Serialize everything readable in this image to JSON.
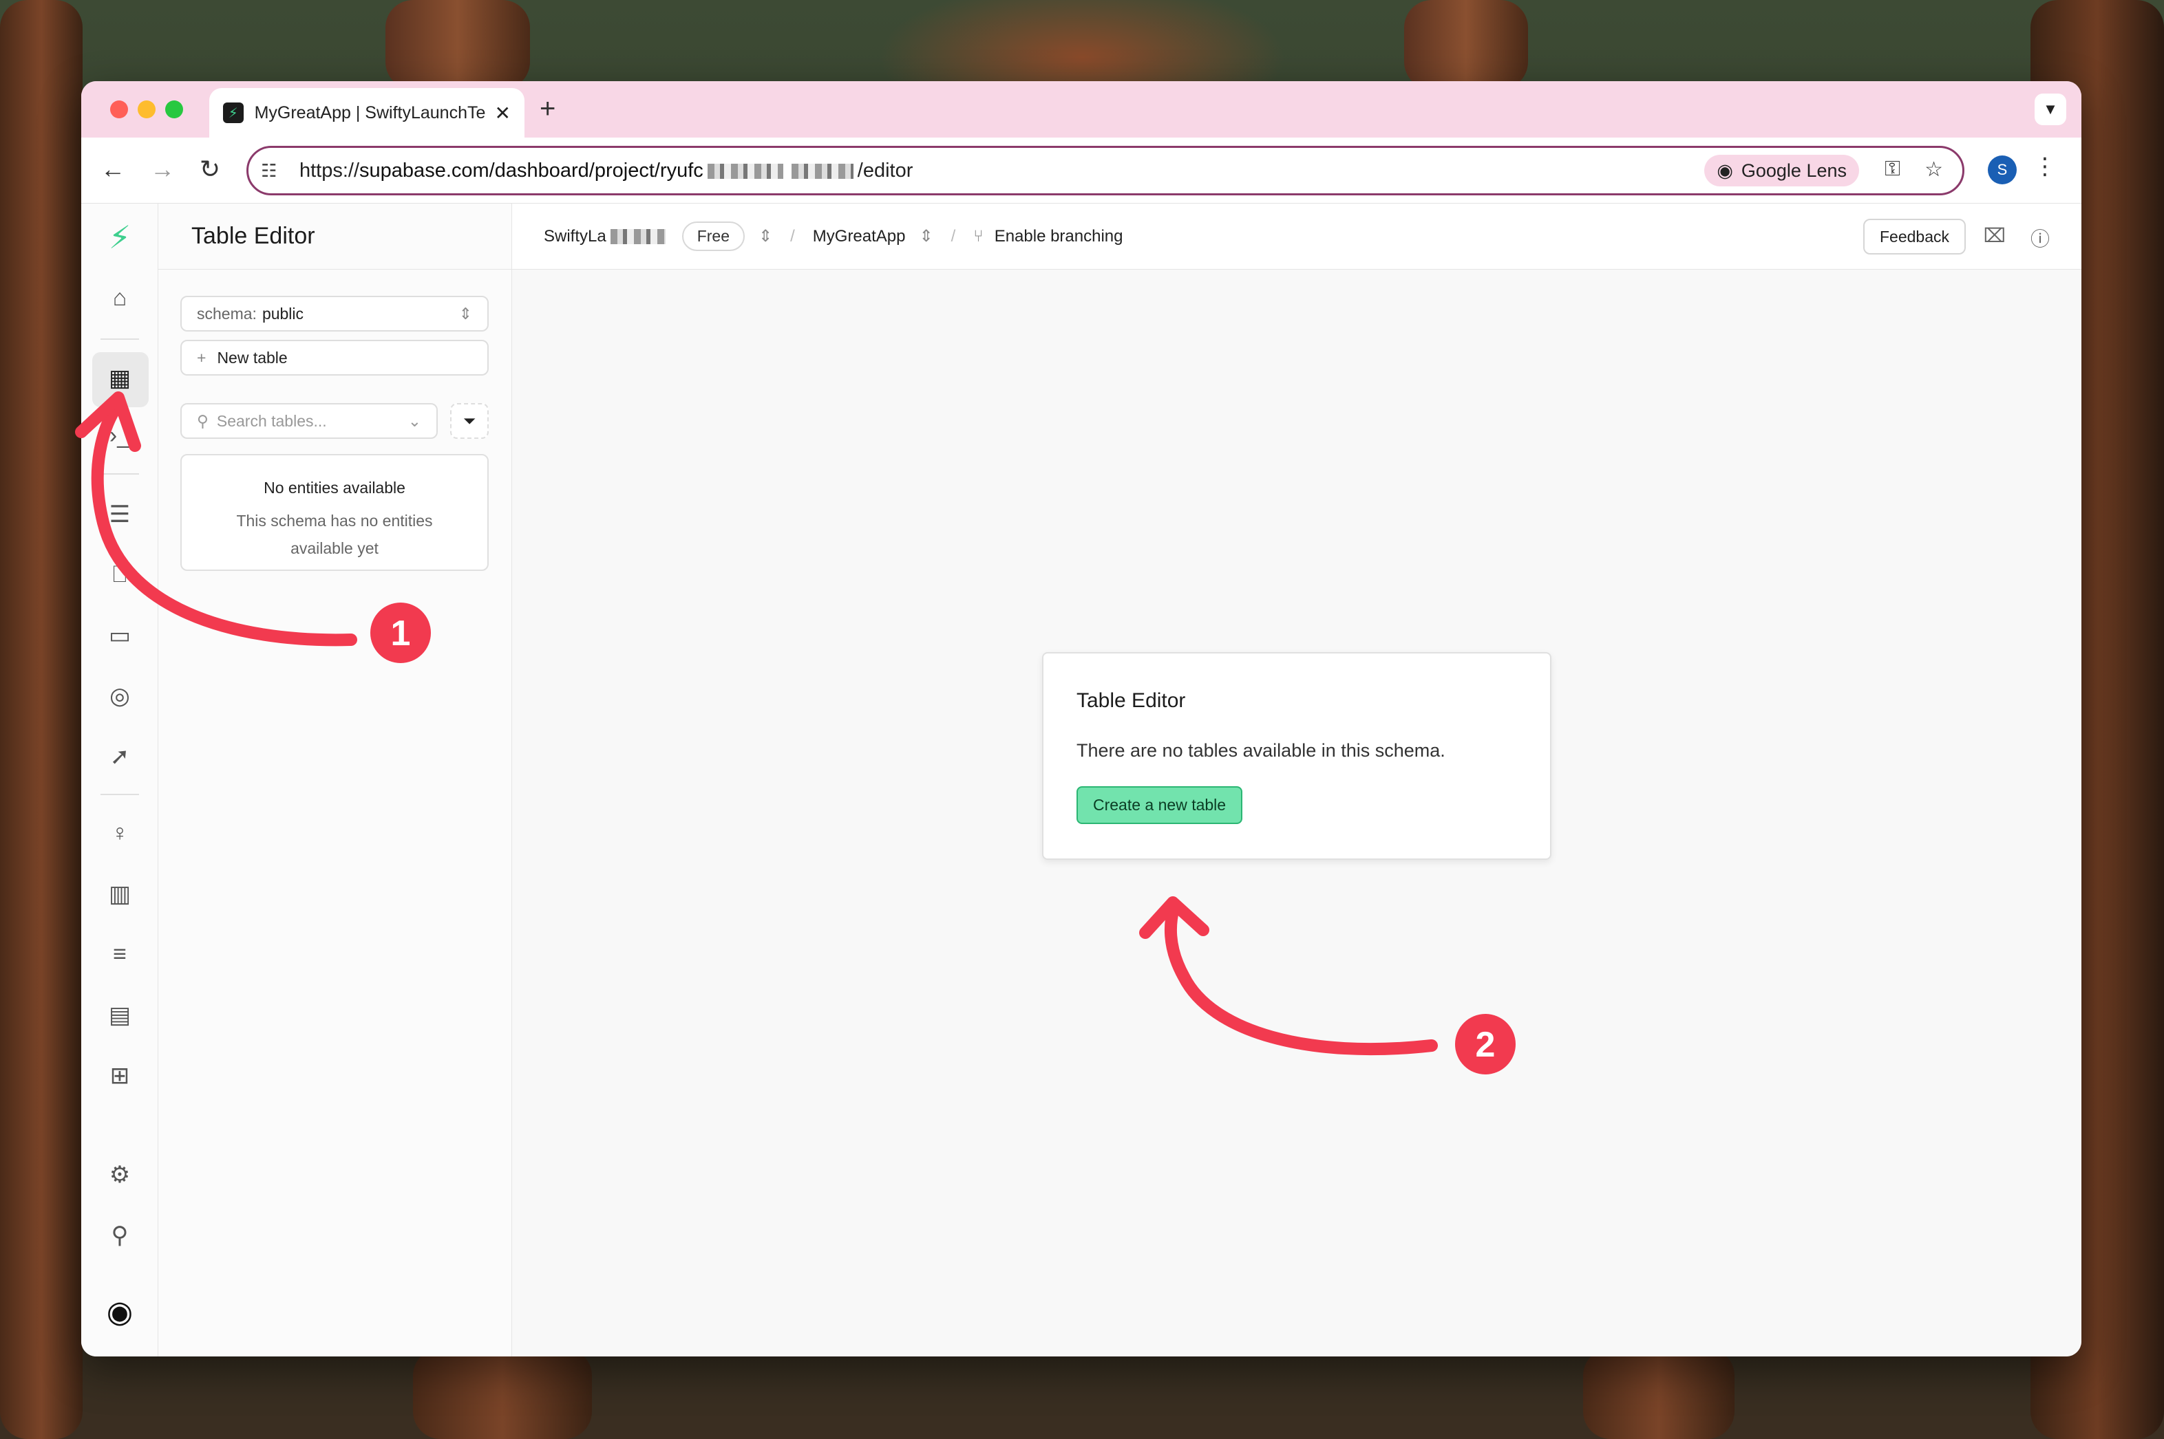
{
  "browser": {
    "tab_title": "MyGreatApp | SwiftyLaunchTe",
    "new_tab_symbol": "+",
    "tab_close_symbol": "✕",
    "url_prefix": "https://",
    "url_host_path": "supabase.com/dashboard/project/ryufc",
    "url_suffix": "/editor",
    "google_lens_label": "Google Lens",
    "profile_initial": "S"
  },
  "rail": {
    "icons": [
      "supabase-logo-icon",
      "home-icon",
      "table-editor-icon",
      "sql-editor-icon",
      "database-icon",
      "authentication-icon",
      "storage-icon",
      "edge-functions-icon",
      "realtime-icon",
      "advisors-icon",
      "reports-icon",
      "logs-icon",
      "api-docs-icon",
      "integrations-icon",
      "settings-icon",
      "search-icon",
      "account-icon"
    ]
  },
  "sidebar": {
    "title": "Table Editor",
    "schema_label": "schema:",
    "schema_value": "public",
    "new_table_label": "New table",
    "search_placeholder": "Search tables...",
    "empty_title": "No entities available",
    "empty_desc_line1": "This schema has no entities",
    "empty_desc_line2": "available yet"
  },
  "topbar": {
    "org_name": "SwiftyLa",
    "plan_badge": "Free",
    "project_name": "MyGreatApp",
    "branching_label": "Enable branching",
    "feedback_label": "Feedback",
    "separator": "/"
  },
  "main": {
    "card_title": "Table Editor",
    "card_desc": "There are no tables available in this schema.",
    "create_button_label": "Create a new table"
  },
  "annotations": {
    "step1": "1",
    "step2": "2",
    "arrow_color": "#f23a4f"
  },
  "colors": {
    "brand": "#3ecf8e",
    "tab_strip": "#f8d7e6",
    "omnibox_border": "#8b3a6b"
  }
}
